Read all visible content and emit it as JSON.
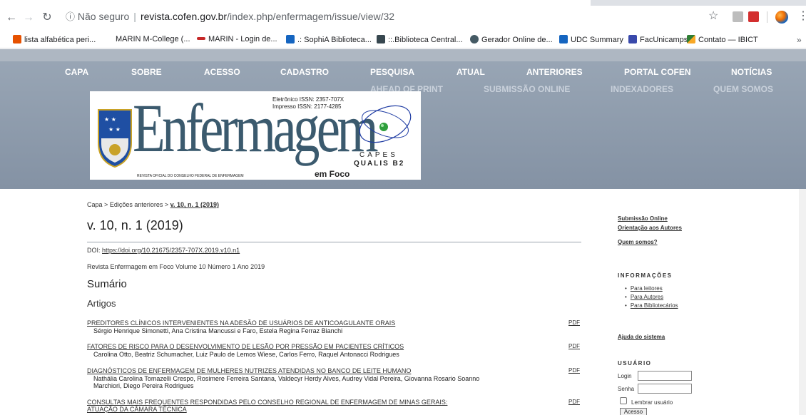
{
  "browser": {
    "url_info_icon": "ⓘ",
    "security_label": "Não seguro",
    "url_host": "revista.cofen.gov.br",
    "url_path": "/index.php/enfermagem/issue/view/32",
    "bookmarks": [
      "lista alfabética peri...",
      "MARIN M-College (...",
      "MARIN - Login de...",
      ".: SophiA Biblioteca...",
      "::.Biblioteca Central...",
      "Gerador Online de...",
      "UDC Summary",
      "FacUnicamps",
      "Contato — IBICT"
    ],
    "bookmarks_more": "»"
  },
  "nav": {
    "row1": [
      "CAPA",
      "SOBRE",
      "ACESSO",
      "CADASTRO",
      "PESQUISA",
      "ATUAL",
      "ANTERIORES",
      "PORTAL COFEN",
      "NOTÍCIAS"
    ],
    "row2": [
      "AHEAD OF PRINT",
      "SUBMISSÃO ONLINE",
      "INDEXADORES",
      "QUEM SOMOS"
    ]
  },
  "banner": {
    "title": "Enfermagem",
    "issn_electronic": "Eletrônico ISSN: 2357-707X",
    "issn_print": "Impresso ISSN: 2177-4285",
    "subtitle_line": "REVISTA OFICIAL DO CONSELHO FEDERAL DE ENFERMAGEM",
    "em_foco": "em Foco",
    "capes": "CAPES",
    "qualis": "QUALIS B2"
  },
  "breadcrumb": {
    "home": "Capa",
    "sep": ">",
    "previous": "Edições anteriores",
    "current": "v. 10, n. 1 (2019)"
  },
  "issue": {
    "title": "v. 10, n. 1 (2019)",
    "doi_label": "DOI:",
    "doi_link": "https://doi.org/10.21675/2357-707X.2019.v10.n1",
    "description": "Revista Enfermagem em Foco Volume 10 Número 1 Ano 2019",
    "sumario": "Sumário",
    "section": "Artigos"
  },
  "articles": [
    {
      "title": "PREDITORES CLÍNICOS INTERVENIENTES NA ADESÃO DE USUÁRIOS DE ANTICOAGULANTE ORAIS",
      "authors": "Sérgio Henrique Simonetti, Ana Cristina Mancussi e Faro, Estela Regina Ferraz Bianchi",
      "pdf": "PDF"
    },
    {
      "title": "FATORES DE RISCO PARA O DESENVOLVIMENTO DE LESÃO POR PRESSÃO EM PACIENTES CRÍTICOS",
      "authors": "Carolina Otto, Beatriz Schumacher, Luiz Paulo de Lemos Wiese, Carlos Ferro, Raquel Antonacci Rodrigues",
      "pdf": "PDF"
    },
    {
      "title": "DIAGNÓSTICOS DE ENFERMAGEM DE MULHERES NUTRIZES ATENDIDAS NO BANCO DE LEITE HUMANO",
      "authors": "Nathália Carolina Tomazelli Crespo, Rosimere Ferreira Santana, Valdecyr Herdy Alves, Audrey Vidal Pereira, Giovanna Rosario Soanno Marchiori, Diego Pereira Rodrigues",
      "pdf": "PDF"
    },
    {
      "title": "CONSULTAS MAIS FREQUENTES RESPONDIDAS PELO CONSELHO REGIONAL DE ENFERMAGEM DE MINAS GERAIS: ATUAÇÃO DA CÂMARA TÉCNICA",
      "authors": "",
      "pdf": "PDF"
    }
  ],
  "sidebar": {
    "submissao": "Submissão Online",
    "orientacao": "Orientação aos Autores",
    "quem_somos": "Quem somos?",
    "info_heading": "INFORMAÇÕES",
    "info_links": [
      "Para leitores",
      "Para Autores",
      "Para Bibliotecários"
    ],
    "ajuda": "Ajuda do sistema",
    "user_heading": "USUÁRIO",
    "login_label": "Login",
    "senha_label": "Senha",
    "remember_label": "Lembrar usuário",
    "acesso_button": "Acesso"
  }
}
